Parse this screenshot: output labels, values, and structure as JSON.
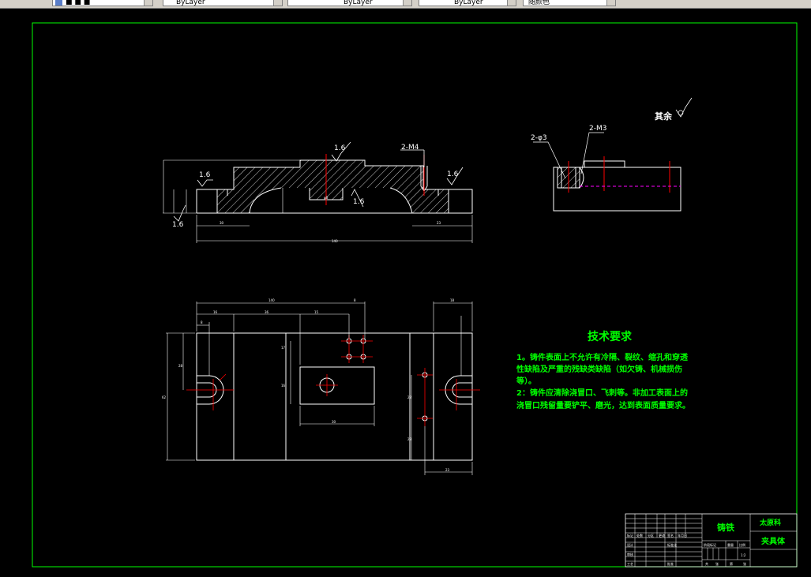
{
  "toolbar": {
    "color_field": "ByLayer",
    "linetype_field": "ByLayer",
    "lineweight_field": "ByLayer",
    "plotstyle_field": "随颜色"
  },
  "drawing": {
    "roughness_other": "其余",
    "front_view": {
      "rough_1": "1.6",
      "rough_2": "1.6",
      "rough_3": "1.6",
      "rough_4": "1.6",
      "rough_5": "1.6",
      "thread_label": "2-M4"
    },
    "side_view": {
      "hole_label": "2-φ3",
      "thread_label": "2-M3"
    },
    "tech_req": {
      "title": "技术要求",
      "line1": "1。铸件表面上不允许有冷隔、裂纹、缩孔和穿透",
      "line2": "性缺陷及严重的残缺类缺陷（如欠铸、机械损伤",
      "line3": "等）。",
      "line4": "2：铸件应清除浇冒口、飞刺等。非加工表面上的",
      "line5": "浇冒口残留量要铲平、磨光，达到表面质量要求。"
    },
    "title_block": {
      "material": "铸铁",
      "company": "太原科",
      "part_name": "夹具体"
    }
  }
}
